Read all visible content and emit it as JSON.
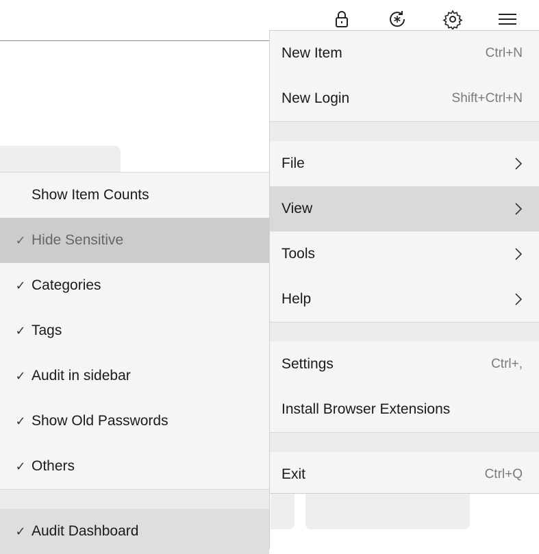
{
  "toolbar": {
    "icons": [
      "lock-icon",
      "refresh-star-icon",
      "gear-icon",
      "hamburger-icon"
    ]
  },
  "main_menu": {
    "new_item": {
      "label": "New Item",
      "shortcut": "Ctrl+N"
    },
    "new_login": {
      "label": "New Login",
      "shortcut": "Shift+Ctrl+N"
    },
    "file": {
      "label": "File"
    },
    "view": {
      "label": "View"
    },
    "tools": {
      "label": "Tools"
    },
    "help": {
      "label": "Help"
    },
    "settings": {
      "label": "Settings",
      "shortcut": "Ctrl+,"
    },
    "install_ext": {
      "label": "Install Browser Extensions"
    },
    "exit": {
      "label": "Exit",
      "shortcut": "Ctrl+Q"
    }
  },
  "view_submenu": {
    "items": [
      {
        "label": "Show Item Counts",
        "checked": false
      },
      {
        "label": "Hide Sensitive",
        "checked": true
      },
      {
        "label": "Categories",
        "checked": true
      },
      {
        "label": "Tags",
        "checked": true
      },
      {
        "label": "Audit in sidebar",
        "checked": true
      },
      {
        "label": "Show Old Passwords",
        "checked": true
      },
      {
        "label": "Others",
        "checked": true
      },
      {
        "label": "Audit Dashboard",
        "checked": true
      }
    ],
    "check_glyph": "✓"
  }
}
